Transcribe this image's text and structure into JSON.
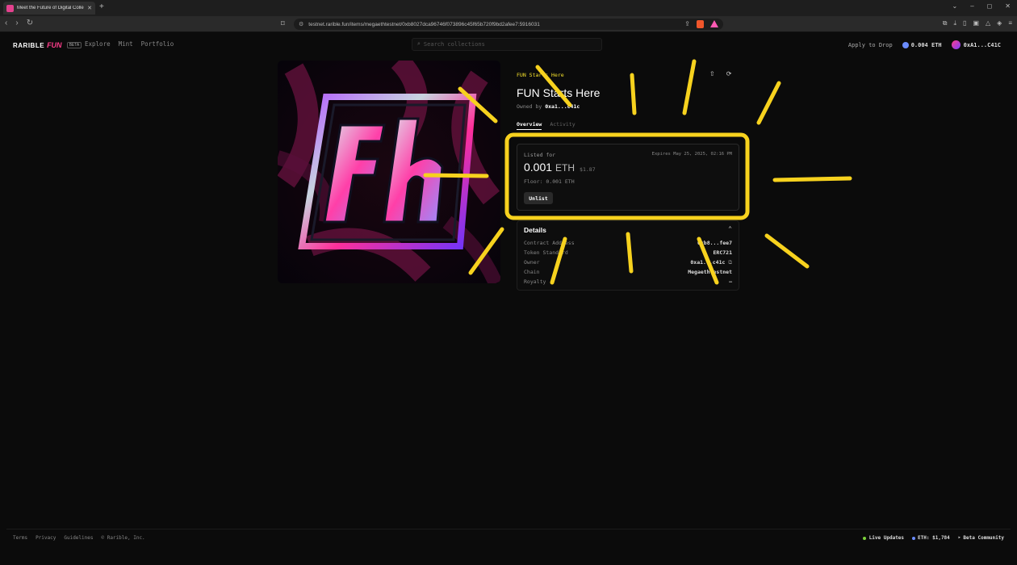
{
  "browser": {
    "tab_title": "Meet the Future of Digital Colle",
    "url": "testnet.rarible.fun/items/megaethtestnet/0xb8027dca96746f073896c45f65b720f9bd2afee7:5916031"
  },
  "header": {
    "logo": "RARIBLE",
    "logo_fun": "FUN",
    "logo_badge": "BETA",
    "nav": [
      "Explore",
      "Mint",
      "Portfolio"
    ],
    "search_placeholder": "Search collections",
    "apply": "Apply to Drop",
    "balance": "0.004 ETH",
    "account": "0xA1...C41C"
  },
  "nft": {
    "collection": "FUN Starts Here",
    "title": "FUN Starts Here",
    "owned_label": "Owned by",
    "owner": "0xa1...c41c",
    "tabs": [
      "Overview",
      "Activity"
    ]
  },
  "listing": {
    "label": "Listed for",
    "expires": "Expires May 25, 2025, 02:16 PM",
    "price": "0.001",
    "currency": "ETH",
    "usd": "$1.87",
    "floor": "Floor: 0.001 ETH",
    "unlist": "Unlist"
  },
  "details": {
    "title": "Details",
    "rows": [
      {
        "key": "Contract Address",
        "value": "0xb8...fee7"
      },
      {
        "key": "Token Standard",
        "value": "ERC721"
      },
      {
        "key": "Owner",
        "value": "0xa1...c41c"
      },
      {
        "key": "Chain",
        "value": "MegaethTestnet"
      },
      {
        "key": "Royalty",
        "value": "–"
      }
    ]
  },
  "footer": {
    "links": [
      "Terms",
      "Privacy",
      "Guidelines",
      "© Rarible, Inc."
    ],
    "live": "Live Updates",
    "eth_price": "ETH: $1,784",
    "community": "Beta Community"
  },
  "colors": {
    "accent": "#f5e12b",
    "brand": "#ff3d8b"
  }
}
